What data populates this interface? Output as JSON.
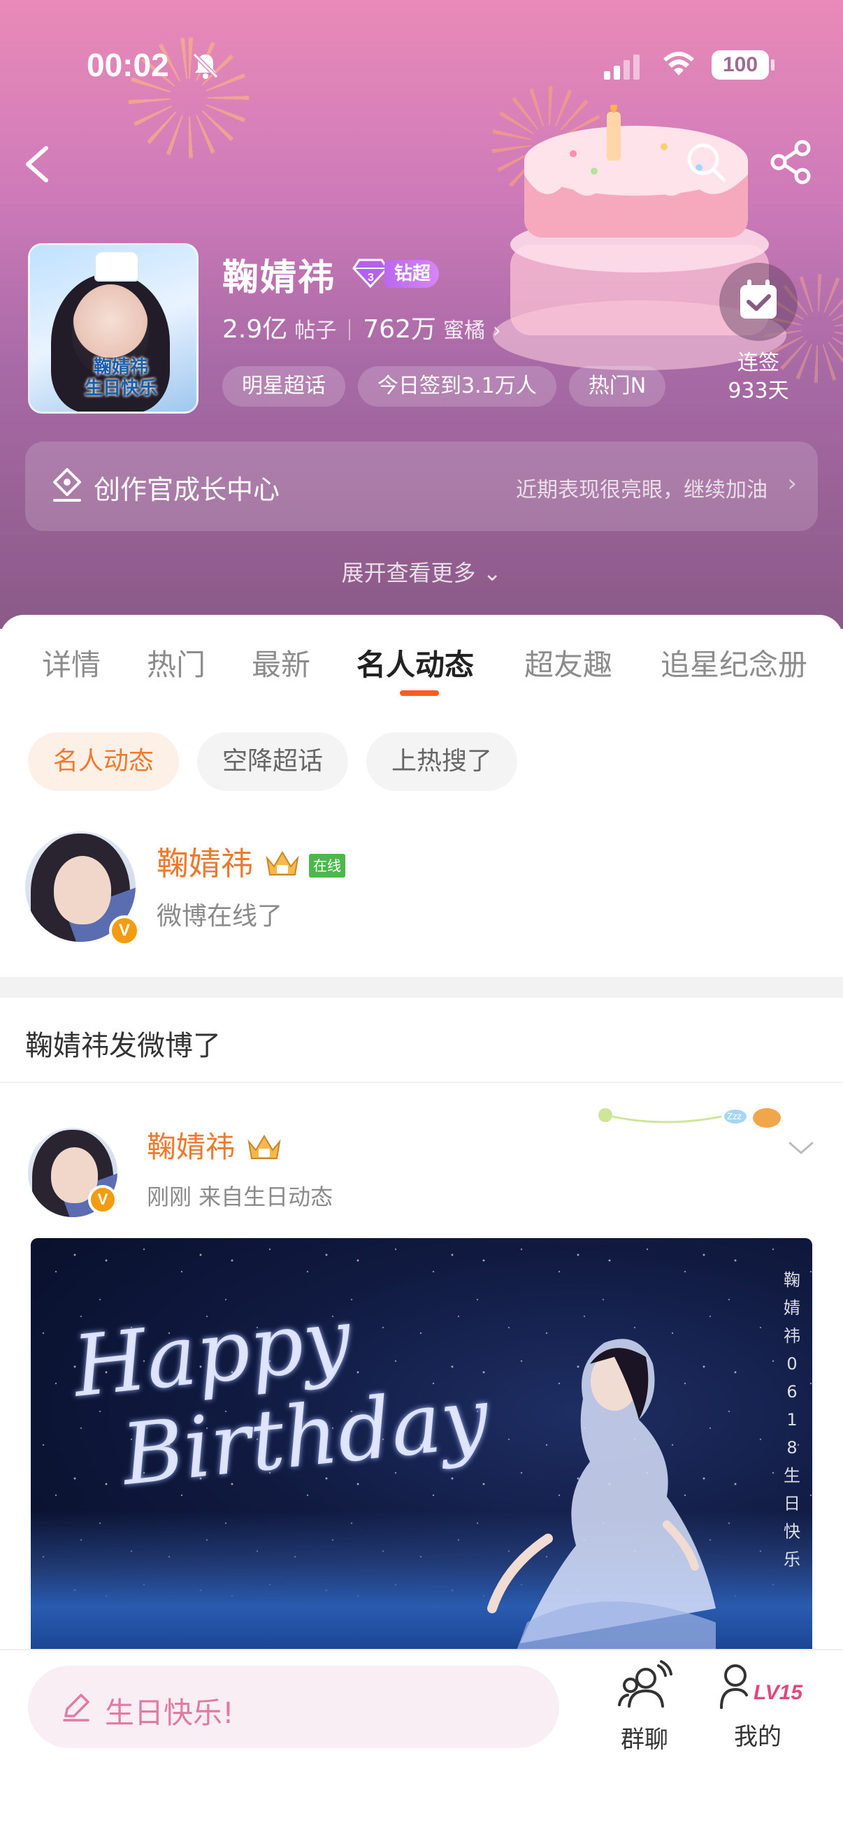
{
  "status_bar": {
    "time": "00:02",
    "battery": "100"
  },
  "topic": {
    "name": "鞠婧祎",
    "badge": "钻超",
    "posts_count": "2.9亿",
    "posts_unit": "帖子",
    "fans_count": "762万",
    "fans_unit": "蜜橘",
    "tags": [
      "明星超话",
      "今日签到3.1万人",
      "热门N"
    ],
    "cover_caption": "鞠婧祎\n生日快乐"
  },
  "checkin": {
    "label": "连签",
    "days": "933天"
  },
  "growth": {
    "title": "创作官成长中心",
    "subtitle": "近期表现很亮眼，继续加油"
  },
  "expand_label": "展开查看更多",
  "tabs": [
    "详情",
    "热门",
    "最新",
    "名人动态",
    "超友趣",
    "追星纪念册"
  ],
  "active_tab": "名人动态",
  "subtabs": [
    "名人动态",
    "空降超话",
    "上热搜了"
  ],
  "online": {
    "name": "鞠婧祎",
    "tag": "在线",
    "text": "微博在线了"
  },
  "section_title": "鞠婧祎发微博了",
  "post": {
    "author": "鞠婧祎",
    "meta": "刚刚  来自生日动态",
    "image": {
      "text_line1": "Happy",
      "text_line2": "Birthday",
      "vertical_text": "鞠婧祎0618生日快乐"
    }
  },
  "bottom_bar": {
    "comment_placeholder": "生日快乐!",
    "group_chat_label": "群聊",
    "mine_label": "我的",
    "level": "LV15"
  },
  "colors": {
    "accent_orange": "#eb7a2f",
    "tab_indicator": "#ff5a1f",
    "vip_purple": "#c478f2",
    "comment_pink": "#e07ba3"
  }
}
